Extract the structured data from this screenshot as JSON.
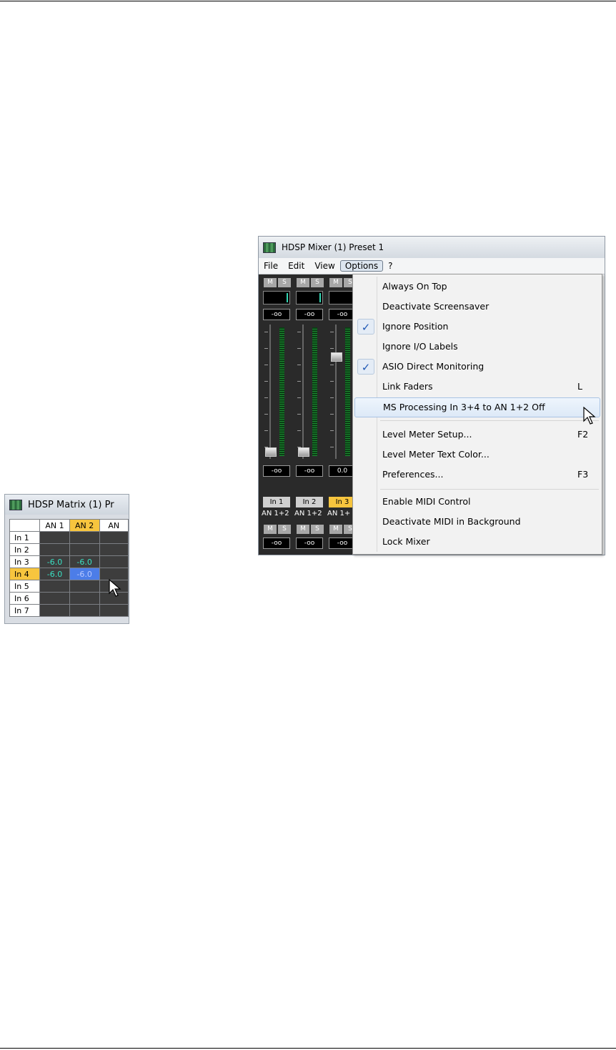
{
  "matrix_window": {
    "title": "HDSP Matrix (1) Pr",
    "columns": [
      "AN 1",
      "AN 2",
      "AN"
    ],
    "rows": [
      {
        "label": "In 1",
        "cells": [
          "",
          "",
          ""
        ]
      },
      {
        "label": "In 2",
        "cells": [
          "",
          "",
          ""
        ]
      },
      {
        "label": "In 3",
        "cells": [
          "-6.0",
          "-6.0",
          ""
        ]
      },
      {
        "label": "In 4",
        "cells": [
          "-6.0",
          "-6.0",
          ""
        ]
      },
      {
        "label": "In 5",
        "cells": [
          "",
          "",
          ""
        ]
      },
      {
        "label": "In 6",
        "cells": [
          "",
          "",
          ""
        ]
      },
      {
        "label": "In 7",
        "cells": [
          "",
          "",
          ""
        ]
      }
    ]
  },
  "mixer_window": {
    "title": "HDSP Mixer (1) Preset 1",
    "menu": [
      "File",
      "Edit",
      "View",
      "Options",
      "?"
    ],
    "channels": [
      {
        "mute": "M",
        "solo": "S",
        "top_value": "-oo",
        "fader_value": "-oo",
        "name": "In 1",
        "output": "AN 1+2",
        "bottom_value": "-oo"
      },
      {
        "mute": "M",
        "solo": "S",
        "top_value": "-oo",
        "fader_value": "-oo",
        "name": "In 2",
        "output": "AN 1+2",
        "bottom_value": "-oo"
      },
      {
        "mute": "M",
        "solo": "S",
        "top_value": "-oo",
        "fader_value": "0.0",
        "name": "In 3",
        "output": "AN 1+",
        "bottom_value": "-oo"
      }
    ],
    "options_menu": {
      "items": [
        {
          "label": "Always On Top",
          "shortcut": "",
          "checked": false
        },
        {
          "label": "Deactivate Screensaver",
          "shortcut": "",
          "checked": false
        },
        {
          "label": "Ignore Position",
          "shortcut": "",
          "checked": true
        },
        {
          "label": "Ignore I/O Labels",
          "shortcut": "",
          "checked": false
        },
        {
          "label": "ASIO Direct Monitoring",
          "shortcut": "",
          "checked": true
        },
        {
          "label": "Link Faders",
          "shortcut": "L",
          "checked": false
        },
        {
          "label": "MS Processing In 3+4 to AN 1+2 Off",
          "shortcut": "",
          "checked": false
        },
        {
          "label": "Level Meter Setup...",
          "shortcut": "F2",
          "checked": false
        },
        {
          "label": "Level Meter Text Color...",
          "shortcut": "",
          "checked": false
        },
        {
          "label": "Preferences...",
          "shortcut": "F3",
          "checked": false
        },
        {
          "label": "Enable MIDI Control",
          "shortcut": "",
          "checked": false
        },
        {
          "label": "Deactivate MIDI in Background",
          "shortcut": "",
          "checked": false
        },
        {
          "label": "Lock Mixer",
          "shortcut": "",
          "checked": false
        }
      ],
      "check_glyph": "✓"
    }
  }
}
